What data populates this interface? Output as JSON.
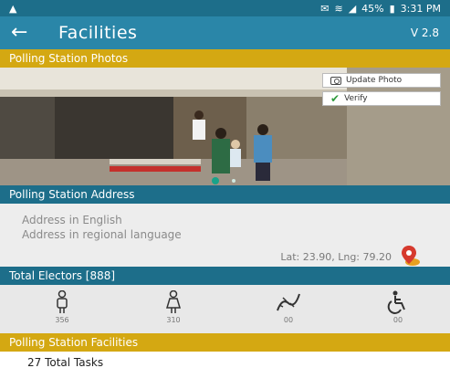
{
  "status_bar": {
    "left_icon": "warning-icon",
    "battery": "45%",
    "time": "3:31 PM"
  },
  "app_bar": {
    "back_icon": "back-arrow-icon",
    "title": "Facilities",
    "version": "V 2.8"
  },
  "photos": {
    "header": "Polling Station Photos",
    "update_button": "Update Photo",
    "verify_button": "Verify"
  },
  "address": {
    "header": "Polling Station Address",
    "english": "Address in English",
    "regional": "Address in regional language",
    "latlng": "Lat: 23.90, Lng: 79.20"
  },
  "electors": {
    "header": "Total Electors [888]",
    "items": [
      {
        "icon": "male-voter-icon",
        "count": "356"
      },
      {
        "icon": "female-voter-icon",
        "count": "310"
      },
      {
        "icon": "third-gender-icon",
        "count": "00"
      },
      {
        "icon": "wheelchair-icon",
        "count": "00"
      }
    ]
  },
  "facilities": {
    "header": "Polling Station Facilities",
    "total_tasks": "27 Total Tasks"
  },
  "colors": {
    "primary": "#2a86a8",
    "primary_dark": "#1d6e8a",
    "accent": "#d4a812"
  }
}
